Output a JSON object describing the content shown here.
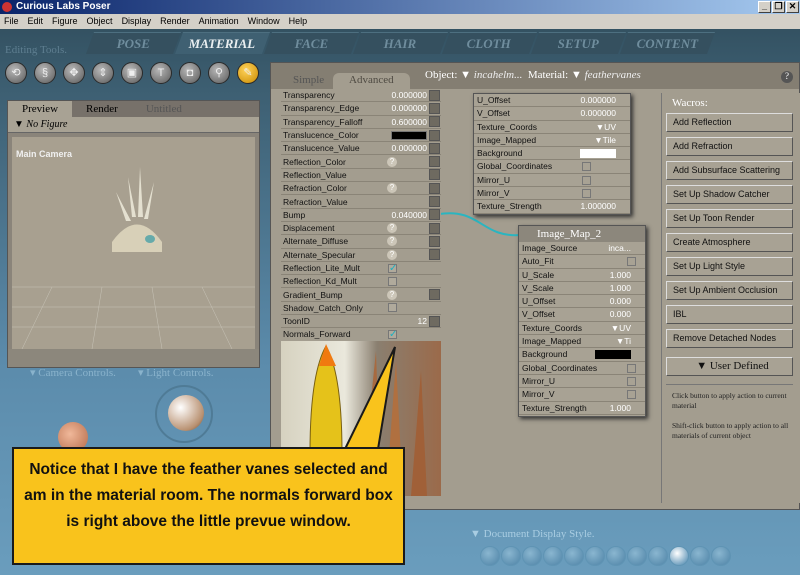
{
  "window": {
    "title": "Curious Labs Poser",
    "min": "_",
    "restore": "❐",
    "close": "✕"
  },
  "menu": [
    "File",
    "Edit",
    "Figure",
    "Object",
    "Display",
    "Render",
    "Animation",
    "Window",
    "Help"
  ],
  "rooms": [
    "POSE",
    "MATERIAL",
    "FACE",
    "HAIR",
    "CLOTH",
    "SETUP",
    "CONTENT"
  ],
  "active_room": "MATERIAL",
  "editing_tools": {
    "label": "Editing Tools.",
    "tools": [
      {
        "name": "rotate-icon",
        "glyph": "⟲"
      },
      {
        "name": "twist-icon",
        "glyph": "§"
      },
      {
        "name": "translate-icon",
        "glyph": "✥"
      },
      {
        "name": "translate-z-icon",
        "glyph": "⇕"
      },
      {
        "name": "scale-icon",
        "glyph": "▣"
      },
      {
        "name": "taper-icon",
        "glyph": "T"
      },
      {
        "name": "chain-break-icon",
        "glyph": "◘"
      },
      {
        "name": "zoom-icon",
        "glyph": "⚲"
      },
      {
        "name": "eyedropper-icon",
        "glyph": "✎"
      }
    ]
  },
  "preview": {
    "tabs": [
      "Preview",
      "Render"
    ],
    "doc_title": "Untitled",
    "figure_select": "No Figure",
    "camera": "Main Camera"
  },
  "controls": {
    "camera": "Camera Controls.",
    "light": "Light Controls."
  },
  "material": {
    "tabs": [
      "Simple",
      "Advanced"
    ],
    "active_tab": "Advanced",
    "object_label": "Object:",
    "object": "incahelm...",
    "material_label": "Material:",
    "material": "feathervanes",
    "help": "?",
    "params": [
      {
        "name": "Transparency",
        "value": "0.000000"
      },
      {
        "name": "Transparency_Edge",
        "value": "0.000000"
      },
      {
        "name": "Transparency_Falloff",
        "value": "0.600000"
      },
      {
        "name": "Translucence_Color",
        "type": "swatch"
      },
      {
        "name": "Translucence_Value",
        "value": "0.000000"
      },
      {
        "name": "Reflection_Color",
        "type": "q"
      },
      {
        "name": "Reflection_Value"
      },
      {
        "name": "Refraction_Color",
        "type": "q"
      },
      {
        "name": "Refraction_Value"
      },
      {
        "name": "Bump",
        "value": "0.040000"
      },
      {
        "name": "Displacement",
        "type": "q"
      },
      {
        "name": "Alternate_Diffuse",
        "type": "q"
      },
      {
        "name": "Alternate_Specular",
        "type": "q"
      },
      {
        "name": "Reflection_Lite_Mult",
        "type": "cb",
        "checked": true
      },
      {
        "name": "Reflection_Kd_Mult",
        "type": "cb",
        "checked": false
      },
      {
        "name": "Gradient_Bump",
        "type": "q"
      },
      {
        "name": "Shadow_Catch_Only",
        "type": "cb",
        "checked": false
      },
      {
        "name": "ToonID",
        "value": "12"
      },
      {
        "name": "Normals_Forward",
        "type": "cb",
        "checked": true
      }
    ],
    "node_a": [
      {
        "name": "U_Offset",
        "value": "0.000000"
      },
      {
        "name": "V_Offset",
        "value": "0.000000"
      },
      {
        "name": "Texture_Coords",
        "value": "▼UV"
      },
      {
        "name": "Image_Mapped",
        "value": "▼Tile"
      },
      {
        "name": "Background",
        "type": "swatch-white"
      },
      {
        "name": "Global_Coordinates",
        "type": "cb"
      },
      {
        "name": "Mirror_U",
        "type": "cb"
      },
      {
        "name": "Mirror_V",
        "type": "cb"
      },
      {
        "name": "Texture_Strength",
        "value": "1.000000"
      }
    ],
    "node_b": {
      "title": "Image_Map_2",
      "rows": [
        {
          "name": "Image_Source",
          "value": "inca..."
        },
        {
          "name": "Auto_Fit",
          "type": "cb"
        },
        {
          "name": "U_Scale",
          "value": "1.000"
        },
        {
          "name": "V_Scale",
          "value": "1.000"
        },
        {
          "name": "U_Offset",
          "value": "0.000"
        },
        {
          "name": "V_Offset",
          "value": "0.000"
        },
        {
          "name": "Texture_Coords",
          "value": "▼UV"
        },
        {
          "name": "Image_Mapped",
          "value": "▼Ti"
        },
        {
          "name": "Background",
          "type": "swatch-black"
        },
        {
          "name": "Global_Coordinates",
          "type": "cb"
        },
        {
          "name": "Mirror_U",
          "type": "cb"
        },
        {
          "name": "Mirror_V",
          "type": "cb"
        },
        {
          "name": "Texture_Strength",
          "value": "1.000"
        }
      ]
    }
  },
  "wacros": {
    "label": "Wacros:",
    "buttons": [
      "Add Reflection",
      "Add Refraction",
      "Add Subsurface Scattering",
      "Set Up Shadow Catcher",
      "Set Up Toon Render",
      "Create Atmosphere",
      "Set Up Light Style",
      "Set Up Ambient Occlusion",
      "IBL",
      "Remove Detached Nodes"
    ],
    "user_defined": "▼ User Defined",
    "hint1": "Click button to apply action to current material",
    "hint2": "Shift-click button to apply action to all materials of current object"
  },
  "document_display": {
    "label": "▼ Document Display Style.",
    "count": 12,
    "active_index": 9
  },
  "callout": "Notice that I have the feather vanes selected and am in the material room.  The normals forward box is right above the little prevue window.",
  "colors": {
    "callout": "#f9c31c",
    "wire": "#2ab5c0",
    "panel": "#a39d8f"
  }
}
